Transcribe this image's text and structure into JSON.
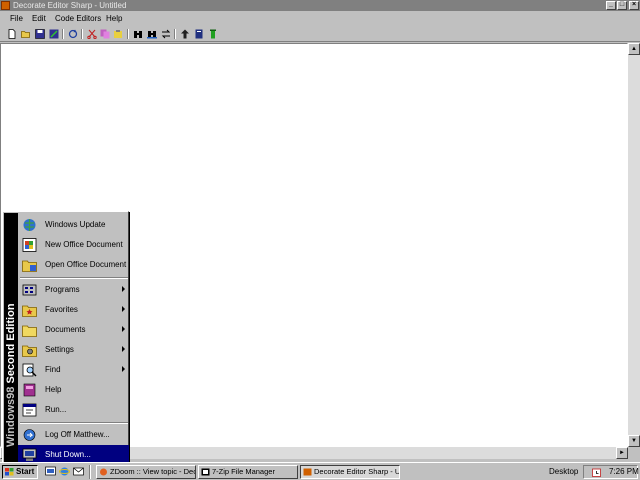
{
  "window": {
    "title": "Decorate Editor Sharp - Untitled",
    "controls": {
      "minimize": "_",
      "maximize": "□",
      "close": "×"
    }
  },
  "menubar": {
    "items": [
      {
        "label": "File"
      },
      {
        "label": "Edit"
      },
      {
        "label": "Code Editors"
      },
      {
        "label": "Help"
      }
    ]
  },
  "toolbar": {
    "buttons": [
      "new-file-icon",
      "open-folder-icon",
      "save-icon",
      "save-as-icon",
      "refresh-icon",
      "cut-icon",
      "copy-icon",
      "paste-icon",
      "find-icon",
      "find-replace-icon",
      "replace-icon",
      "pointer-icon",
      "book-icon",
      "marker-icon"
    ]
  },
  "editor": {
    "content": ""
  },
  "scrollbars": {
    "up": "▲",
    "down": "▼",
    "left": "◄",
    "right": "►"
  },
  "startmenu": {
    "banner_bold": "Windows98",
    "banner_rest": " Second Edition",
    "items": [
      {
        "label": "Windows Update",
        "icon": "windows-update-icon"
      },
      {
        "label": "New Office Document",
        "icon": "new-office-document-icon"
      },
      {
        "label": "Open Office Document",
        "icon": "open-office-document-icon"
      },
      {
        "label": "Programs",
        "icon": "programs-icon"
      },
      {
        "label": "Favorites",
        "icon": "favorites-icon"
      },
      {
        "label": "Documents",
        "icon": "documents-icon"
      },
      {
        "label": "Settings",
        "icon": "settings-icon"
      },
      {
        "label": "Find",
        "icon": "find-icon"
      },
      {
        "label": "Help",
        "icon": "help-icon"
      },
      {
        "label": "Run...",
        "icon": "run-icon"
      },
      {
        "label": "Log Off Matthew...",
        "icon": "log-off-icon"
      },
      {
        "label": "Shut Down...",
        "icon": "shut-down-icon"
      }
    ]
  },
  "taskbar": {
    "start_label": "Start",
    "tasks": [
      {
        "label": "ZDoom :: View topic - Dec..."
      },
      {
        "label": "7-Zip File Manager"
      },
      {
        "label": "Decorate Editor Sharp - U..."
      }
    ],
    "desktop_label": "Desktop",
    "clock": "7:26 PM"
  },
  "colors": {
    "face": "#c0c0c0",
    "title_inactive": "#808080",
    "highlight": "#000080",
    "editor_bg": "#ffffff"
  }
}
